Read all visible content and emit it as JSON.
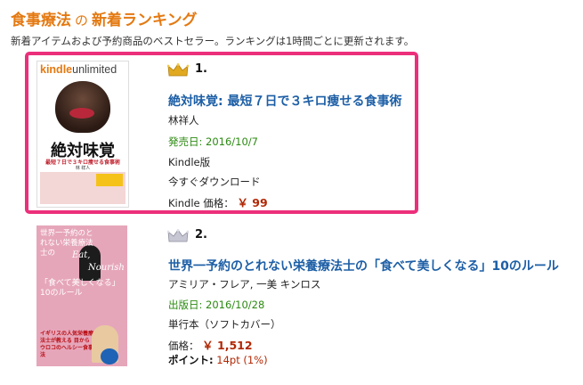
{
  "header": {
    "title_main": "食事療法",
    "title_mid": "の",
    "title_tail": "新着ランキング",
    "subtitle": "新着アイテムおよび予約商品のベストセラー。ランキングは1時間ごとに更新されます。"
  },
  "items": [
    {
      "rank": "1.",
      "title": "絶対味覚: 最短７日で３キロ痩せる食事術",
      "author": "林祥人",
      "date": "発売日: 2016/10/7",
      "format": "Kindle版",
      "availability": "今すぐダウンロード",
      "price_label": "Kindle 価格：",
      "price": "￥ 99",
      "cover": {
        "brand_1": "kindle",
        "brand_2": "unlimited",
        "main": "絶対味覚",
        "sub": "最短７日で３キロ痩せる食事術",
        "author": "林 祥人"
      }
    },
    {
      "rank": "2.",
      "title": "世界一予約のとれない栄養療法士の「食べて美しくなる」10のルール",
      "author": "アミリア・フレア, 一美 キンロス",
      "date": "出版日: 2016/10/28",
      "format": "単行本（ソフトカバー）",
      "price_label": "価格：",
      "price": "￥ 1,512",
      "points_label": "ポイント:",
      "points_value": "14pt (1%)",
      "cover": {
        "top": "世界一予約のとれない栄養療法士の",
        "eat": "Eat,",
        "nourish": "Nourish",
        "main": "「食べて美しくなる」10のルール",
        "red": "イギリスの人気栄養療法士が教える 目からウロコのヘルシー食事法"
      }
    }
  ],
  "colors": {
    "accent": "#e47911",
    "link": "#1d5fa6",
    "price": "#b12704",
    "date1": "#2b8a11",
    "highlight": "#ec2f7b"
  }
}
